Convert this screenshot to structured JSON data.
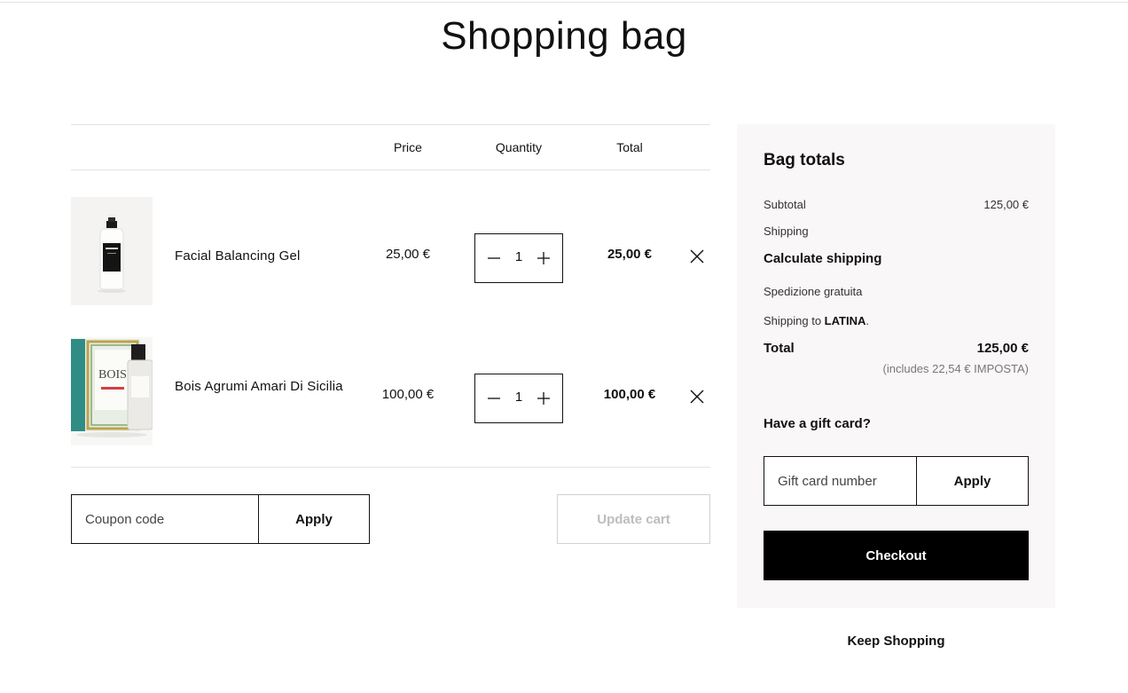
{
  "page": {
    "title": "Shopping bag"
  },
  "cart": {
    "headers": {
      "price": "Price",
      "quantity": "Quantity",
      "total": "Total"
    },
    "items": [
      {
        "name": "Facial Balancing Gel",
        "price": "25,00 €",
        "quantity": "1",
        "total": "25,00 €",
        "image": "white-bottle-product-image"
      },
      {
        "name": "Bois Agrumi Amari Di Sicilia",
        "price": "100,00 €",
        "quantity": "1",
        "total": "100,00 €",
        "image": "perfume-box-product-image",
        "box_label": "BOIS"
      }
    ],
    "coupon_placeholder": "Coupon code",
    "coupon_apply": "Apply",
    "update_cart": "Update cart"
  },
  "totals": {
    "title": "Bag totals",
    "subtotal_label": "Subtotal",
    "subtotal_value": "125,00 €",
    "shipping_label": "Shipping",
    "calculate_shipping": "Calculate shipping",
    "free_shipping": "Spedizione gratuita",
    "shipping_to_prefix": "Shipping to ",
    "shipping_to_city": "LATINA",
    "shipping_to_suffix": ".",
    "total_label": "Total",
    "total_value": "125,00 €",
    "tax_note": "(includes 22,54 € IMPOSTA)",
    "gift_question": "Have a gift card?",
    "gift_placeholder": "Gift card number",
    "gift_apply": "Apply",
    "checkout": "Checkout"
  },
  "keep_shopping": "Keep Shopping",
  "colors": {
    "panel_bg": "#f9f7f7",
    "checkout_bg": "#000000",
    "disabled_text": "#bdbdbd"
  }
}
